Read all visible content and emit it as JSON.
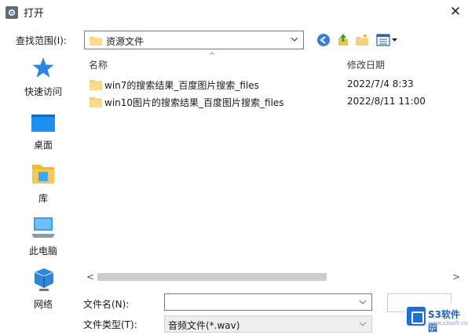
{
  "window": {
    "title": "打开",
    "close_glyph": "✕"
  },
  "lookin": {
    "label": "查找范围(I):",
    "value": "资源文件"
  },
  "toolbar": {
    "back_icon": "back-arrow-icon",
    "up_icon": "up-folder-icon",
    "newfolder_icon": "new-folder-icon",
    "view_icon": "view-menu-icon"
  },
  "places": [
    {
      "label": "快速访问",
      "icon": "star-icon"
    },
    {
      "label": "桌面",
      "icon": "desktop-icon"
    },
    {
      "label": "库",
      "icon": "library-icon"
    },
    {
      "label": "此电脑",
      "icon": "computer-icon"
    },
    {
      "label": "网络",
      "icon": "network-icon"
    }
  ],
  "columns": {
    "name": "名称",
    "date": "修改日期"
  },
  "files": [
    {
      "name": "win7的搜索结果_百度图片搜索_files",
      "date": "2022/7/4 8:33"
    },
    {
      "name": "win10图片的搜索结果_百度图片搜索_files",
      "date": "2022/8/11 11:00"
    }
  ],
  "footer": {
    "filename_label": "文件名(N):",
    "filename_value": "",
    "filetype_label": "文件类型(T):",
    "filetype_value": "音频文件(*.wav)"
  },
  "watermark": {
    "text": "S3软件园",
    "sub": "www.s3soft.com"
  },
  "colors": {
    "accent": "#0078d7",
    "folder": "#f5d27a"
  }
}
